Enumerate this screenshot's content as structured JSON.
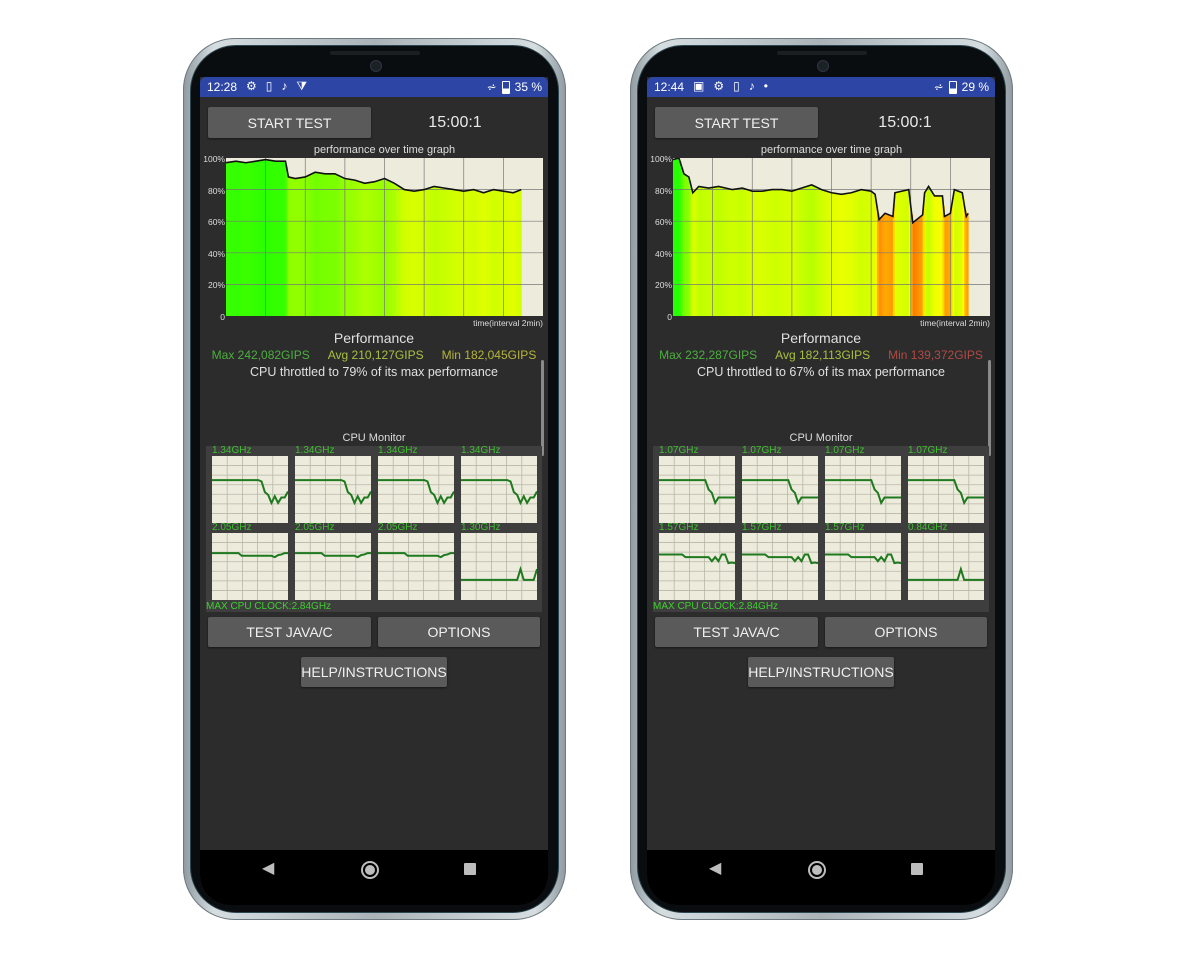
{
  "phones": [
    {
      "status": {
        "time": "12:28",
        "icons": [
          "gear-icon",
          "sim-icon",
          "music-note-icon",
          "play-store-icon"
        ],
        "icon_glyphs": [
          "⚙",
          "▯",
          "♪",
          "⧩"
        ],
        "battery": "35 %"
      },
      "start_label": "START TEST",
      "timer": "15:00:1",
      "graph_title": "performance over time graph",
      "y_ticks": [
        "100%",
        "80%",
        "60%",
        "40%",
        "20%",
        "0"
      ],
      "x_label": "time(interval 2min)",
      "chart_data": {
        "type": "area",
        "xlabel": "time(interval 2min)",
        "x_unit": "min",
        "xlim": [
          0,
          16
        ],
        "ylim": [
          0,
          100
        ],
        "grid": true,
        "x": [
          0,
          0.5,
          1,
          1.5,
          2,
          2.5,
          3,
          3.15,
          3.5,
          4,
          4.5,
          5,
          5.5,
          6,
          6.5,
          7,
          7.5,
          8,
          8.5,
          9,
          9.5,
          10,
          10.5,
          11,
          11.5,
          12,
          12.5,
          13,
          13.5,
          14,
          14.5,
          14.9
        ],
        "y": [
          97,
          98,
          97,
          98,
          99,
          98,
          98,
          88,
          87,
          88,
          91,
          90,
          90,
          87,
          86,
          84,
          85,
          87,
          84,
          80,
          79,
          80,
          82,
          81,
          80,
          79,
          80,
          78,
          80,
          79,
          78,
          80
        ]
      },
      "perf_title": "Performance",
      "max": "Max 242,082GIPS",
      "avg": "Avg 210,127GIPS",
      "min": "Min 182,045GIPS",
      "min_color": "#b5b53a",
      "throttle": "CPU throttled to 79% of its max performance",
      "cpu_title": "CPU Monitor",
      "cores": [
        {
          "freq": "1.34GHz",
          "levels": [
            0.64,
            0.64,
            0.64,
            0.64,
            0.64,
            0.64,
            0.64,
            0.64,
            0.64,
            0.64,
            0.64,
            0.64,
            0.64,
            0.64,
            0.64,
            0.62,
            0.46,
            0.42,
            0.3,
            0.4,
            0.3,
            0.38,
            0.38,
            0.47
          ]
        },
        {
          "freq": "1.34GHz",
          "levels": [
            0.64,
            0.64,
            0.64,
            0.64,
            0.64,
            0.64,
            0.64,
            0.64,
            0.64,
            0.64,
            0.64,
            0.64,
            0.64,
            0.64,
            0.64,
            0.62,
            0.46,
            0.42,
            0.3,
            0.4,
            0.3,
            0.38,
            0.38,
            0.47
          ]
        },
        {
          "freq": "1.34GHz",
          "levels": [
            0.64,
            0.64,
            0.64,
            0.64,
            0.64,
            0.64,
            0.64,
            0.64,
            0.64,
            0.64,
            0.64,
            0.64,
            0.64,
            0.64,
            0.64,
            0.62,
            0.46,
            0.42,
            0.3,
            0.4,
            0.3,
            0.38,
            0.38,
            0.47
          ]
        },
        {
          "freq": "1.34GHz",
          "levels": [
            0.64,
            0.64,
            0.64,
            0.64,
            0.64,
            0.64,
            0.64,
            0.64,
            0.64,
            0.64,
            0.64,
            0.64,
            0.64,
            0.64,
            0.64,
            0.62,
            0.46,
            0.42,
            0.3,
            0.4,
            0.3,
            0.38,
            0.38,
            0.47
          ]
        },
        {
          "freq": "2.05GHz",
          "levels": [
            0.7,
            0.7,
            0.7,
            0.7,
            0.7,
            0.7,
            0.7,
            0.7,
            0.7,
            0.66,
            0.66,
            0.66,
            0.66,
            0.66,
            0.66,
            0.66,
            0.66,
            0.66,
            0.66,
            0.64,
            0.67,
            0.68,
            0.7,
            0.7
          ]
        },
        {
          "freq": "2.05GHz",
          "levels": [
            0.7,
            0.7,
            0.7,
            0.7,
            0.7,
            0.7,
            0.7,
            0.7,
            0.7,
            0.66,
            0.66,
            0.66,
            0.66,
            0.66,
            0.66,
            0.66,
            0.66,
            0.66,
            0.66,
            0.64,
            0.67,
            0.68,
            0.7,
            0.7
          ]
        },
        {
          "freq": "2.05GHz",
          "levels": [
            0.7,
            0.7,
            0.7,
            0.7,
            0.7,
            0.7,
            0.7,
            0.7,
            0.7,
            0.66,
            0.66,
            0.66,
            0.66,
            0.66,
            0.66,
            0.66,
            0.66,
            0.66,
            0.66,
            0.64,
            0.67,
            0.68,
            0.7,
            0.7
          ]
        },
        {
          "freq": "1.30GHz",
          "levels": [
            0.3,
            0.3,
            0.3,
            0.3,
            0.3,
            0.3,
            0.3,
            0.3,
            0.3,
            0.3,
            0.3,
            0.3,
            0.3,
            0.3,
            0.3,
            0.3,
            0.3,
            0.3,
            0.46,
            0.3,
            0.3,
            0.3,
            0.3,
            0.46
          ]
        }
      ],
      "max_clock": "MAX CPU CLOCK:2.84GHz",
      "test_label": "TEST JAVA/C",
      "options_label": "OPTIONS",
      "help_label": "HELP/INSTRUCTIONS"
    },
    {
      "status": {
        "time": "12:44",
        "icons": [
          "image-icon",
          "gear-icon",
          "sim-icon",
          "music-note-icon",
          "dot-icon"
        ],
        "icon_glyphs": [
          "▣",
          "⚙",
          "▯",
          "♪",
          "•"
        ],
        "battery": "29 %"
      },
      "start_label": "START TEST",
      "timer": "15:00:1",
      "graph_title": "performance over time graph",
      "y_ticks": [
        "100%",
        "80%",
        "60%",
        "40%",
        "20%",
        "0"
      ],
      "x_label": "time(interval 2min)",
      "chart_data": {
        "type": "area",
        "xlabel": "time(interval 2min)",
        "x_unit": "min",
        "xlim": [
          0,
          16
        ],
        "ylim": [
          0,
          100
        ],
        "grid": true,
        "x": [
          0,
          0.3,
          0.55,
          0.8,
          1.0,
          1.3,
          1.8,
          2.3,
          3,
          3.5,
          4,
          4.5,
          5,
          5.5,
          6,
          6.5,
          7,
          7.5,
          8,
          8.5,
          9,
          9.5,
          10,
          10.2,
          10.4,
          10.7,
          11.1,
          11.2,
          11.9,
          12.1,
          12.6,
          12.7,
          12.9,
          13.2,
          13.6,
          13.7,
          14,
          14.2,
          14.6,
          14.8,
          14.9
        ],
        "y": [
          99,
          100,
          90,
          88,
          78,
          82,
          81,
          82,
          80,
          81,
          79,
          79,
          80,
          80,
          79,
          81,
          83,
          80,
          78,
          77,
          78,
          80,
          79,
          77,
          61,
          65,
          63,
          78,
          80,
          59,
          64,
          78,
          82,
          76,
          76,
          63,
          65,
          80,
          78,
          63,
          65
        ]
      },
      "perf_title": "Performance",
      "max": "Max 232,287GIPS",
      "avg": "Avg 182,113GIPS",
      "min": "Min 139,372GIPS",
      "min_color": "#b04a44",
      "throttle": "CPU throttled to 67% of its max performance",
      "cpu_title": "CPU Monitor",
      "cores": [
        {
          "freq": "1.07GHz",
          "levels": [
            0.64,
            0.64,
            0.64,
            0.64,
            0.64,
            0.64,
            0.64,
            0.64,
            0.64,
            0.64,
            0.64,
            0.64,
            0.64,
            0.64,
            0.64,
            0.5,
            0.45,
            0.3,
            0.38,
            0.38,
            0.38,
            0.38,
            0.38,
            0.38
          ]
        },
        {
          "freq": "1.07GHz",
          "levels": [
            0.64,
            0.64,
            0.64,
            0.64,
            0.64,
            0.64,
            0.64,
            0.64,
            0.64,
            0.64,
            0.64,
            0.64,
            0.64,
            0.64,
            0.64,
            0.5,
            0.45,
            0.3,
            0.38,
            0.38,
            0.38,
            0.38,
            0.38,
            0.38
          ]
        },
        {
          "freq": "1.07GHz",
          "levels": [
            0.64,
            0.64,
            0.64,
            0.64,
            0.64,
            0.64,
            0.64,
            0.64,
            0.64,
            0.64,
            0.64,
            0.64,
            0.64,
            0.64,
            0.64,
            0.5,
            0.45,
            0.3,
            0.38,
            0.38,
            0.38,
            0.38,
            0.38,
            0.38
          ]
        },
        {
          "freq": "1.07GHz",
          "levels": [
            0.64,
            0.64,
            0.64,
            0.64,
            0.64,
            0.64,
            0.64,
            0.64,
            0.64,
            0.64,
            0.64,
            0.64,
            0.64,
            0.64,
            0.64,
            0.5,
            0.45,
            0.3,
            0.38,
            0.38,
            0.38,
            0.38,
            0.38,
            0.38
          ]
        },
        {
          "freq": "1.57GHz",
          "levels": [
            0.68,
            0.68,
            0.68,
            0.68,
            0.68,
            0.68,
            0.68,
            0.68,
            0.64,
            0.64,
            0.64,
            0.64,
            0.64,
            0.64,
            0.64,
            0.64,
            0.58,
            0.64,
            0.58,
            0.68,
            0.68,
            0.55,
            0.56,
            0.55
          ]
        },
        {
          "freq": "1.57GHz",
          "levels": [
            0.68,
            0.68,
            0.68,
            0.68,
            0.68,
            0.68,
            0.68,
            0.68,
            0.64,
            0.64,
            0.64,
            0.64,
            0.64,
            0.64,
            0.64,
            0.64,
            0.58,
            0.64,
            0.58,
            0.68,
            0.68,
            0.55,
            0.56,
            0.55
          ]
        },
        {
          "freq": "1.57GHz",
          "levels": [
            0.68,
            0.68,
            0.68,
            0.68,
            0.68,
            0.68,
            0.68,
            0.68,
            0.64,
            0.64,
            0.64,
            0.64,
            0.64,
            0.64,
            0.64,
            0.64,
            0.58,
            0.64,
            0.58,
            0.68,
            0.68,
            0.55,
            0.56,
            0.55
          ]
        },
        {
          "freq": "0.84GHz",
          "levels": [
            0.3,
            0.3,
            0.3,
            0.3,
            0.3,
            0.3,
            0.3,
            0.3,
            0.3,
            0.3,
            0.3,
            0.3,
            0.3,
            0.3,
            0.3,
            0.3,
            0.46,
            0.3,
            0.3,
            0.3,
            0.3,
            0.3,
            0.3,
            0.3
          ]
        }
      ],
      "max_clock": "MAX CPU CLOCK:2.84GHz",
      "test_label": "TEST JAVA/C",
      "options_label": "OPTIONS",
      "help_label": "HELP/INSTRUCTIONS"
    }
  ],
  "colors": {
    "status_bar": "#2d46a5",
    "max_text": "#4caf3f",
    "avg_text": "#a8c040",
    "core_line": "#1f7a1f",
    "core_label": "#3fbf2f",
    "plot_bg": "#ecebdc"
  }
}
